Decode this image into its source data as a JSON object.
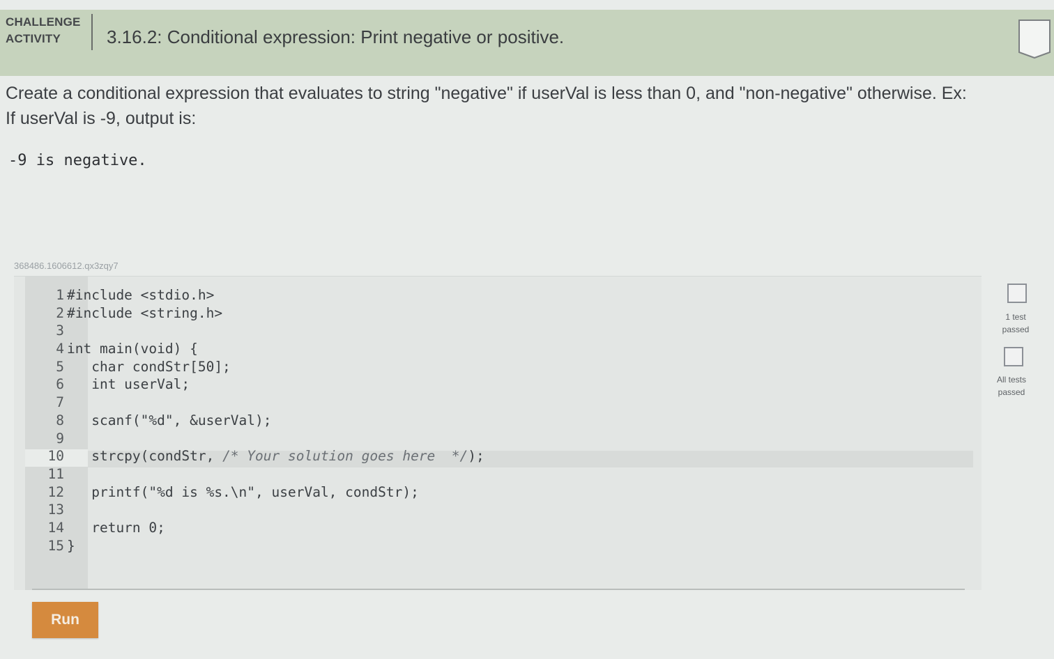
{
  "header": {
    "label_line1": "CHALLENGE",
    "label_line2": "ACTIVITY",
    "title": "3.16.2: Conditional expression: Print negative or positive."
  },
  "instructions": {
    "text": "Create a conditional expression that evaluates to string \"negative\" if userVal is less than 0, and \"non-negative\" otherwise. Ex: If userVal is -9, output is:",
    "example_output": "-9 is negative."
  },
  "editor": {
    "id": "368486.1606612.qx3zqy7",
    "lines": [
      {
        "num": "1",
        "text": "#include <stdio.h>"
      },
      {
        "num": "2",
        "text": "#include <string.h>"
      },
      {
        "num": "3",
        "text": ""
      },
      {
        "num": "4",
        "text": "int main(void) {"
      },
      {
        "num": "5",
        "text": "   char condStr[50];"
      },
      {
        "num": "6",
        "text": "   int userVal;"
      },
      {
        "num": "7",
        "text": ""
      },
      {
        "num": "8",
        "text": "   scanf(\"%d\", &userVal);"
      },
      {
        "num": "9",
        "text": ""
      },
      {
        "num": "10",
        "text_before": "   strcpy(condStr, ",
        "comment": "/* Your solution goes here  */",
        "text_after": ");"
      },
      {
        "num": "11",
        "text": ""
      },
      {
        "num": "12",
        "text": "   printf(\"%d is %s.\\n\", userVal, condStr);"
      },
      {
        "num": "13",
        "text": ""
      },
      {
        "num": "14",
        "text": "   return 0;"
      },
      {
        "num": "15",
        "text": "}"
      }
    ]
  },
  "tests": {
    "one_test_line1": "1 test",
    "one_test_line2": "passed",
    "all_tests_line1": "All tests",
    "all_tests_line2": "passed"
  },
  "run_button": {
    "label": "Run"
  },
  "colors": {
    "header_bg": "#c6d3bd",
    "run_button": "#d58a3e"
  }
}
